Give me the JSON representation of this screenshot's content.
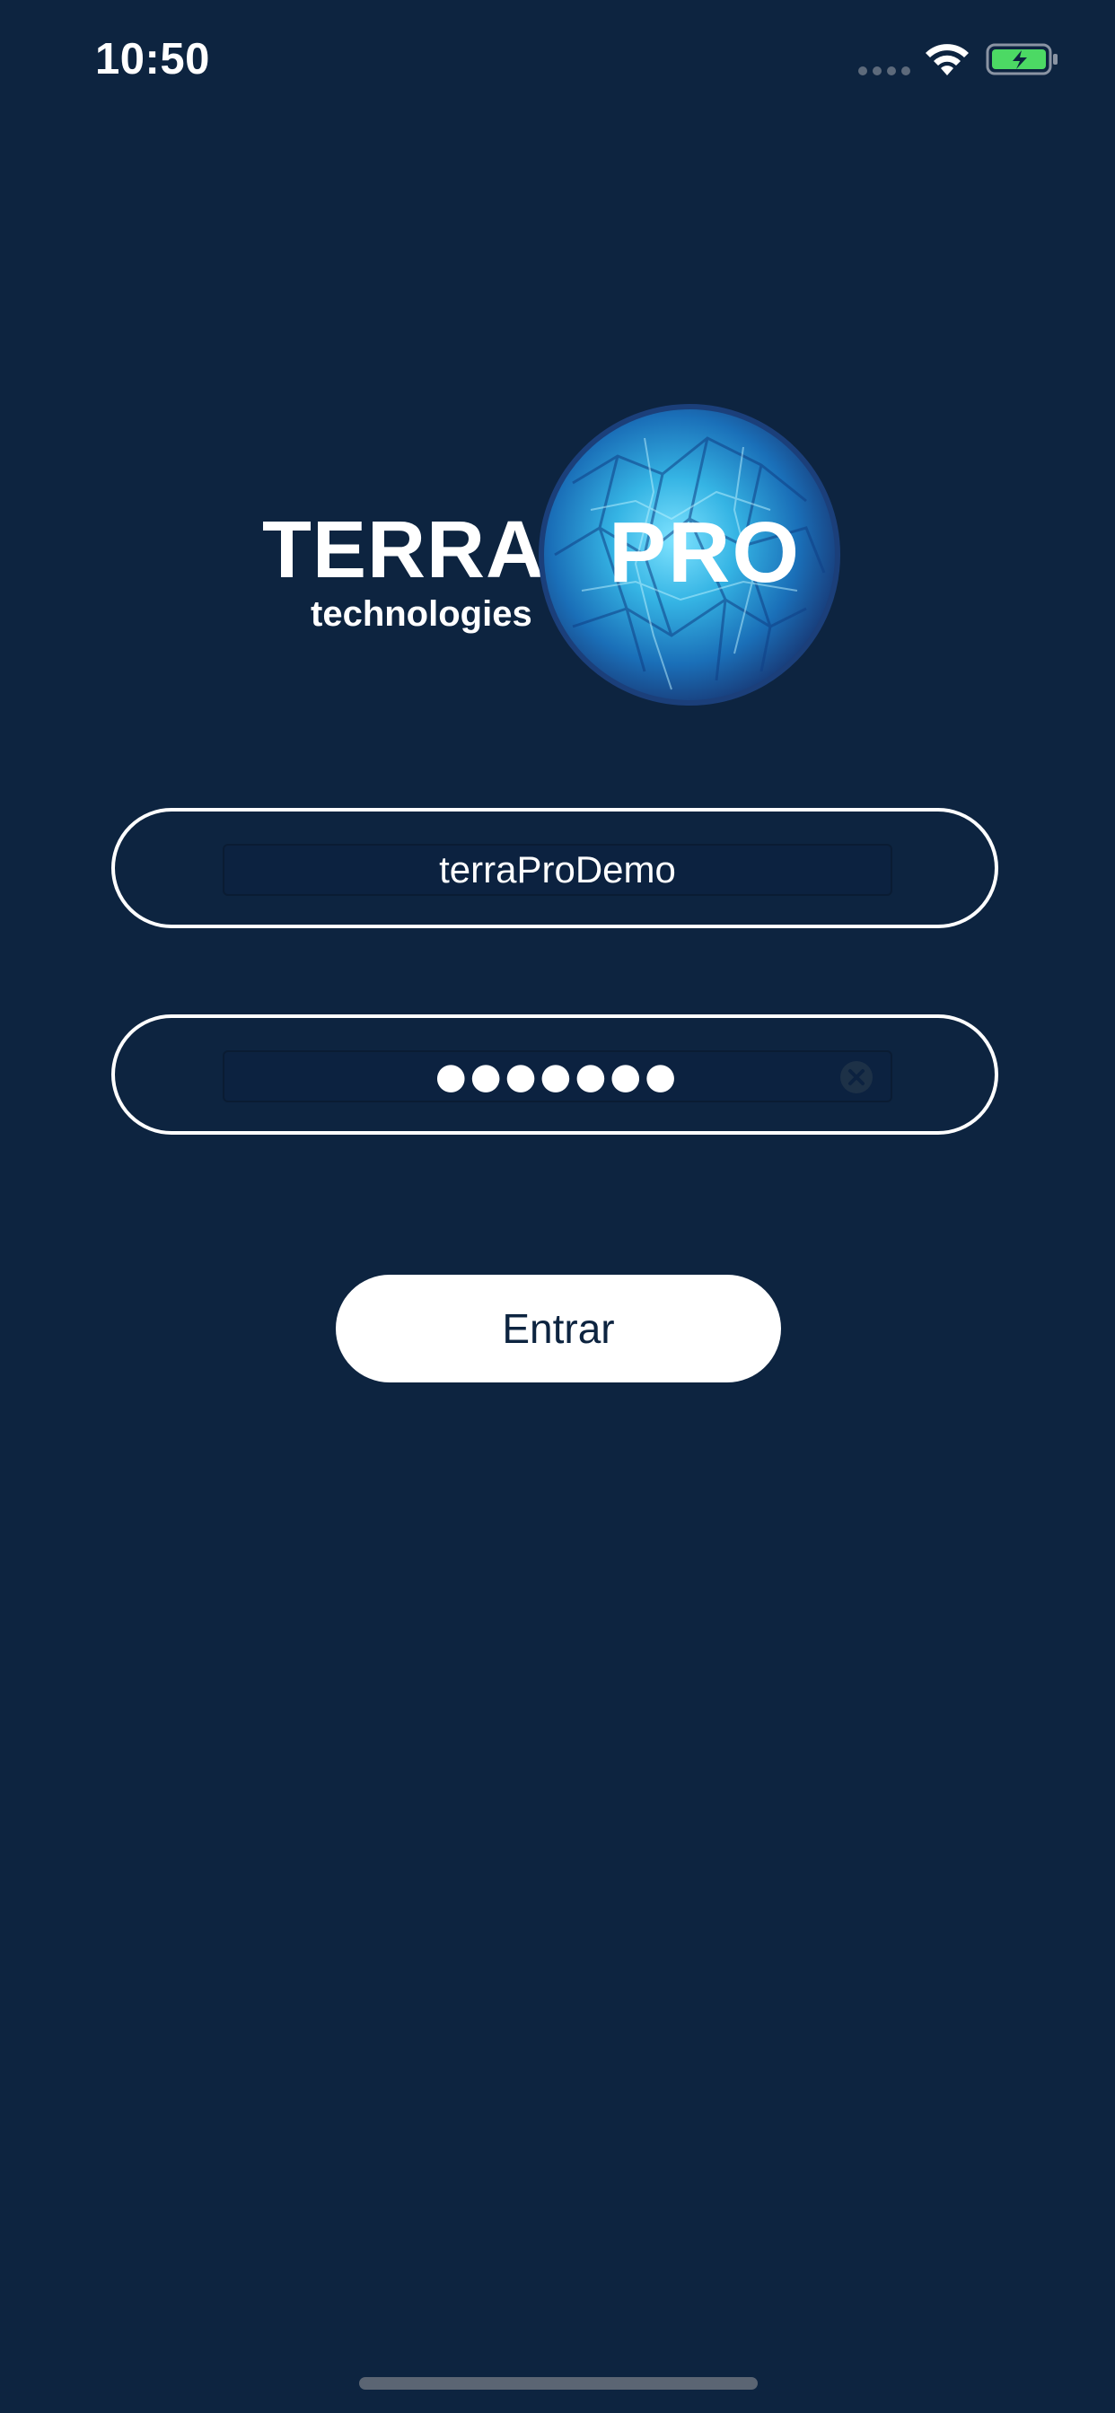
{
  "status_bar": {
    "time": "10:50",
    "icons": [
      "signal-dots-icon",
      "wifi-icon",
      "battery-charging-icon"
    ],
    "battery_color": "#4cd964"
  },
  "logo": {
    "terra": "TERRA",
    "technologies": "technologies",
    "pro": "PRO"
  },
  "login_form": {
    "username_value": "terraProDemo",
    "password_masked": "●●●●●●●",
    "submit_label": "Entrar"
  },
  "colors": {
    "background": "#0d2440",
    "accent": "#2aa7d8",
    "button_bg": "#ffffff",
    "button_text": "#0d2440"
  }
}
